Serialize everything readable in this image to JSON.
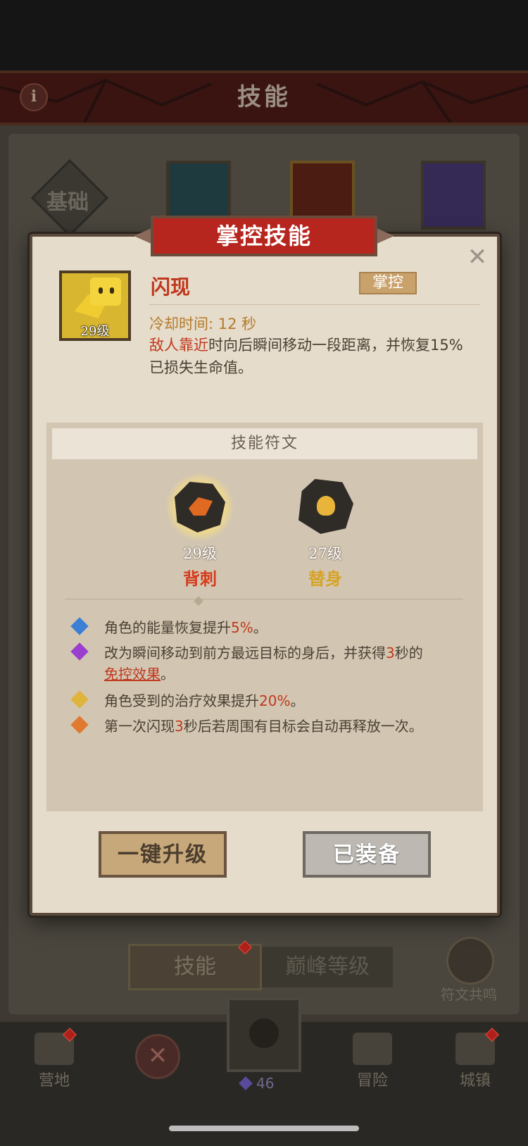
{
  "header": {
    "title": "技能"
  },
  "background": {
    "basic_tab": "基础",
    "bottom_tabs": {
      "skill": "技能",
      "peak": "巅峰等级"
    },
    "resonance_label": "符文共鸣",
    "nav": {
      "camp": "营地",
      "adventure": "冒险",
      "town": "城镇",
      "gem_count": "46"
    }
  },
  "modal": {
    "banner_title": "掌控技能",
    "skill": {
      "name": "闪现",
      "tag": "掌控",
      "level": "29级",
      "cooldown": "冷却时间: 12 秒",
      "desc_highlight": "敌人靠近",
      "desc_rest": "时向后瞬间移动一段距离，并恢复15% 已损失生命值。"
    },
    "rune_section_title": "技能符文",
    "runes": [
      {
        "level": "29级",
        "name": "背刺",
        "color": "#d63a1c",
        "selected": true
      },
      {
        "level": "27级",
        "name": "替身",
        "color": "#d8a324",
        "selected": false
      }
    ],
    "effects": [
      {
        "color": "#3d7fd6",
        "pre": "角色的能量恢复提升",
        "hl": "5%",
        "post": "。"
      },
      {
        "color": "#9a3ed0",
        "pre": "改为瞬间移动到前方最远目标的身后，并获得",
        "hl": "3",
        "mid": "秒的",
        "ul": "免控效果",
        "post": "。"
      },
      {
        "color": "#e0b33a",
        "pre": "角色受到的治疗效果提升",
        "hl": "20%",
        "post": "。"
      },
      {
        "color": "#e07a30",
        "pre": "第一次闪现",
        "hl": "3",
        "post": "秒后若周围有目标会自动再释放一次。"
      }
    ],
    "buttons": {
      "upgrade": "一键升级",
      "equipped": "已装备"
    }
  }
}
